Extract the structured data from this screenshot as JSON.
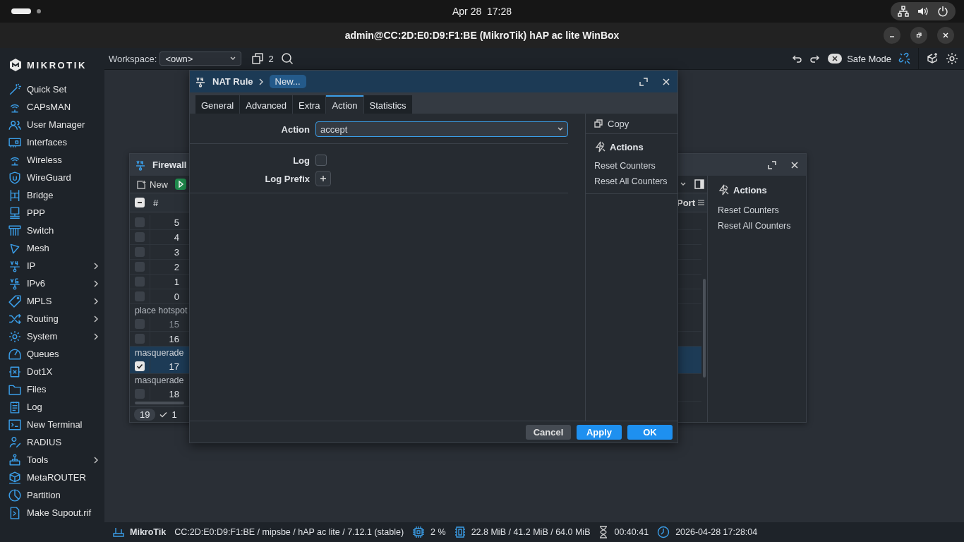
{
  "system_bar": {
    "date": "Apr 28",
    "time": "17:28"
  },
  "window": {
    "title": "admin@CC:2D:E0:D9:F1:BE (MikroTik) hAP ac lite WinBox"
  },
  "logo": "MIKROTIK",
  "toolbar": {
    "workspace_label": "Workspace:",
    "workspace": "<own>",
    "windows_count": "2",
    "safe_mode": {
      "label": "Safe Mode",
      "on": false
    }
  },
  "sidebar": {
    "items": [
      {
        "label": "Quick Set",
        "submenu": false
      },
      {
        "label": "CAPsMAN",
        "submenu": false
      },
      {
        "label": "User Manager",
        "submenu": false
      },
      {
        "label": "Interfaces",
        "submenu": false
      },
      {
        "label": "Wireless",
        "submenu": false
      },
      {
        "label": "WireGuard",
        "submenu": false
      },
      {
        "label": "Bridge",
        "submenu": false
      },
      {
        "label": "PPP",
        "submenu": false
      },
      {
        "label": "Switch",
        "submenu": false
      },
      {
        "label": "Mesh",
        "submenu": false
      },
      {
        "label": "IP",
        "submenu": true
      },
      {
        "label": "IPv6",
        "submenu": true
      },
      {
        "label": "MPLS",
        "submenu": true
      },
      {
        "label": "Routing",
        "submenu": true
      },
      {
        "label": "System",
        "submenu": true
      },
      {
        "label": "Queues",
        "submenu": false
      },
      {
        "label": "Dot1X",
        "submenu": false
      },
      {
        "label": "Files",
        "submenu": false
      },
      {
        "label": "Log",
        "submenu": false
      },
      {
        "label": "New Terminal",
        "submenu": false
      },
      {
        "label": "RADIUS",
        "submenu": false
      },
      {
        "label": "Tools",
        "submenu": true
      },
      {
        "label": "MetaROUTER",
        "submenu": false
      },
      {
        "label": "Partition",
        "submenu": false
      },
      {
        "label": "Make Supout.rif",
        "submenu": false
      }
    ]
  },
  "firewall": {
    "title": "Firewall",
    "new_button": "New",
    "select_all_partial": true,
    "column_1": "#",
    "column_last": "Port",
    "rows": [
      {
        "kind": "rule",
        "number": "5",
        "checked": false,
        "selected": false,
        "disabled": false
      },
      {
        "kind": "rule",
        "number": "4",
        "checked": false,
        "selected": false,
        "disabled": false
      },
      {
        "kind": "rule",
        "number": "3",
        "checked": false,
        "selected": false,
        "disabled": false
      },
      {
        "kind": "rule",
        "number": "2",
        "checked": false,
        "selected": false,
        "disabled": false
      },
      {
        "kind": "rule",
        "number": "1",
        "checked": false,
        "selected": false,
        "disabled": false
      },
      {
        "kind": "rule",
        "number": "0",
        "checked": false,
        "selected": false,
        "disabled": false
      },
      {
        "kind": "group",
        "label": "place hotspot",
        "selected": false
      },
      {
        "kind": "rule",
        "number": "15",
        "checked": false,
        "selected": false,
        "disabled": true
      },
      {
        "kind": "rule",
        "number": "16",
        "checked": false,
        "selected": false,
        "disabled": false
      },
      {
        "kind": "group",
        "label": "masquerade",
        "selected": true
      },
      {
        "kind": "rule",
        "number": "17",
        "checked": true,
        "selected": true,
        "disabled": false
      },
      {
        "kind": "group",
        "label": "masquerade",
        "selected": false
      },
      {
        "kind": "rule",
        "number": "18",
        "checked": false,
        "selected": false,
        "disabled": false
      }
    ],
    "footer_count": "19",
    "footer_selected": "1",
    "actions_title": "Actions",
    "actions": [
      "Reset Counters",
      "Reset All Counters"
    ]
  },
  "dialog": {
    "title": "NAT Rule",
    "crumb": "New...",
    "tabs": [
      {
        "label": "General",
        "selected": false
      },
      {
        "label": "Advanced",
        "selected": false
      },
      {
        "label": "Extra",
        "selected": false
      },
      {
        "label": "Action",
        "selected": true
      },
      {
        "label": "Statistics",
        "selected": false
      }
    ],
    "fields": [
      {
        "kind": "select",
        "label": "Action",
        "value": "accept"
      },
      {
        "kind": "checkbox",
        "label": "Log",
        "checked": false
      },
      {
        "kind": "add",
        "label": "Log Prefix"
      }
    ],
    "copy": "Copy",
    "actions_title": "Actions",
    "actions": [
      "Reset Counters",
      "Reset All Counters"
    ],
    "buttons": [
      {
        "label": "Cancel",
        "kind": "secondary"
      },
      {
        "label": "Apply",
        "kind": "primary"
      },
      {
        "label": "OK",
        "kind": "primary"
      }
    ]
  },
  "status_bar": {
    "brand": "MikroTik",
    "info": "CC:2D:E0:D9:F1:BE / mipsbe / hAP ac lite / 7.12.1 (stable)",
    "cpu": "2 %",
    "memory": "22.8 MiB / 41.2 MiB / 64.0 MiB",
    "uptime": "00:40:41",
    "clock": "2026-04-28 17:28:04"
  }
}
